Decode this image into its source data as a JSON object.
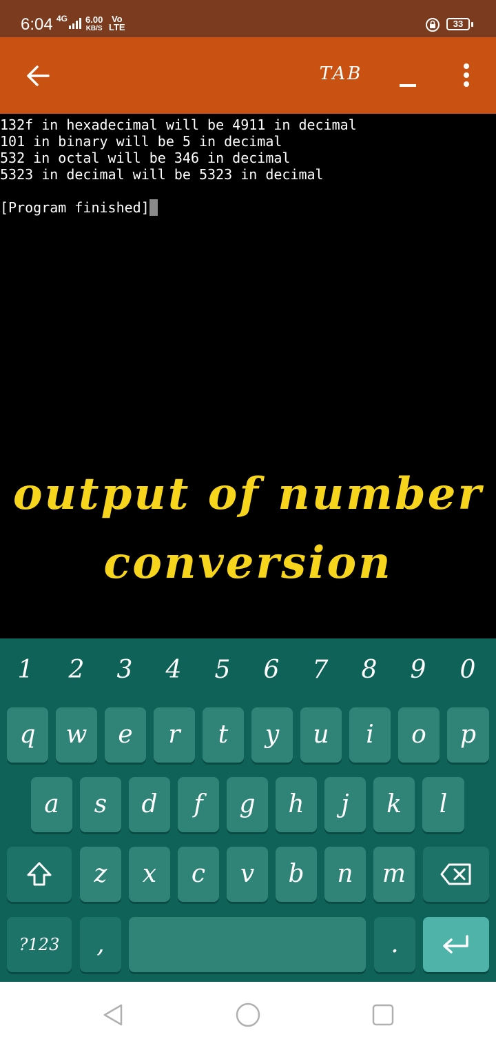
{
  "status_bar": {
    "time": "6:04",
    "network": "4G",
    "speed_value": "6.00",
    "speed_unit": "KB/S",
    "volte_top": "Vo",
    "volte_bottom": "LTE",
    "battery": "33"
  },
  "toolbar": {
    "back_icon": "arrow-left-icon",
    "tab_label": "TAB",
    "minimize_label": "_",
    "more_icon": "more-vertical-icon"
  },
  "terminal": {
    "lines": [
      "132f in hexadecimal will be 4911 in decimal",
      "101 in binary will be 5 in decimal",
      "532 in octal will be 346 in decimal",
      "5323 in decimal will be 5323 in decimal",
      "",
      "[Program finished]"
    ]
  },
  "overlay": {
    "line1": "output of number",
    "line2": "conversion"
  },
  "keyboard": {
    "numbers": [
      "1",
      "2",
      "3",
      "4",
      "5",
      "6",
      "7",
      "8",
      "9",
      "0"
    ],
    "row1": [
      "q",
      "w",
      "e",
      "r",
      "t",
      "y",
      "u",
      "i",
      "o",
      "p"
    ],
    "row2": [
      "a",
      "s",
      "d",
      "f",
      "g",
      "h",
      "j",
      "k",
      "l"
    ],
    "row3": [
      "z",
      "x",
      "c",
      "v",
      "b",
      "n",
      "m"
    ],
    "shift_icon": "shift-icon",
    "backspace_icon": "backspace-icon",
    "symbols_label": "?123",
    "comma_label": ",",
    "period_label": ".",
    "enter_icon": "enter-icon"
  },
  "nav_bar": {
    "back_icon": "nav-back-icon",
    "home_icon": "nav-home-icon",
    "recents_icon": "nav-recents-icon"
  },
  "colors": {
    "status_bar": "#7b3b1e",
    "toolbar": "#c95213",
    "terminal_bg": "#000000",
    "caption": "#f7d51c",
    "keyboard_bg": "#0e6258",
    "key": "#2f8477",
    "enter_key": "#4fb3a9"
  }
}
